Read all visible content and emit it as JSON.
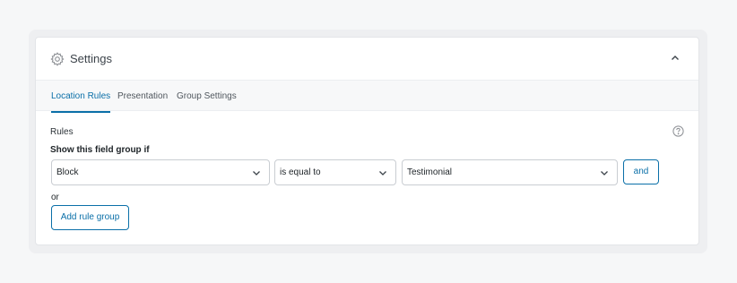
{
  "panel": {
    "title": "Settings",
    "icons": {
      "settings": "gear-icon",
      "collapse": "chevron-up-icon",
      "help": "question-circle-icon",
      "dropdown": "chevron-down-icon"
    }
  },
  "tabs": [
    {
      "label": "Location Rules",
      "active": true
    },
    {
      "label": "Presentation",
      "active": false
    },
    {
      "label": "Group Settings",
      "active": false
    }
  ],
  "rules": {
    "section_label": "Rules",
    "condition_label": "Show this field group if",
    "param_value": "Block",
    "operator_value": "is equal to",
    "target_value": "Testimonial",
    "and_label": "and",
    "or_label": "or",
    "add_group_label": "Add rule group"
  },
  "colors": {
    "accent": "#0a6fa8",
    "page_bg": "#f6f7f8",
    "panel_bg": "#ffffff"
  }
}
